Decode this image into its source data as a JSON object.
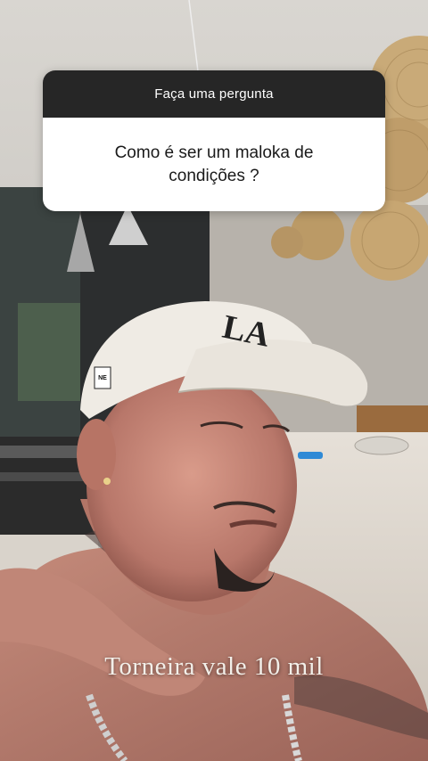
{
  "story": {
    "question_sticker": {
      "header": "Faça uma pergunta",
      "question": "Como é ser um maloka de condições ?"
    },
    "caption": "Torneira vale 10 mil",
    "brand_mark": "NE"
  }
}
